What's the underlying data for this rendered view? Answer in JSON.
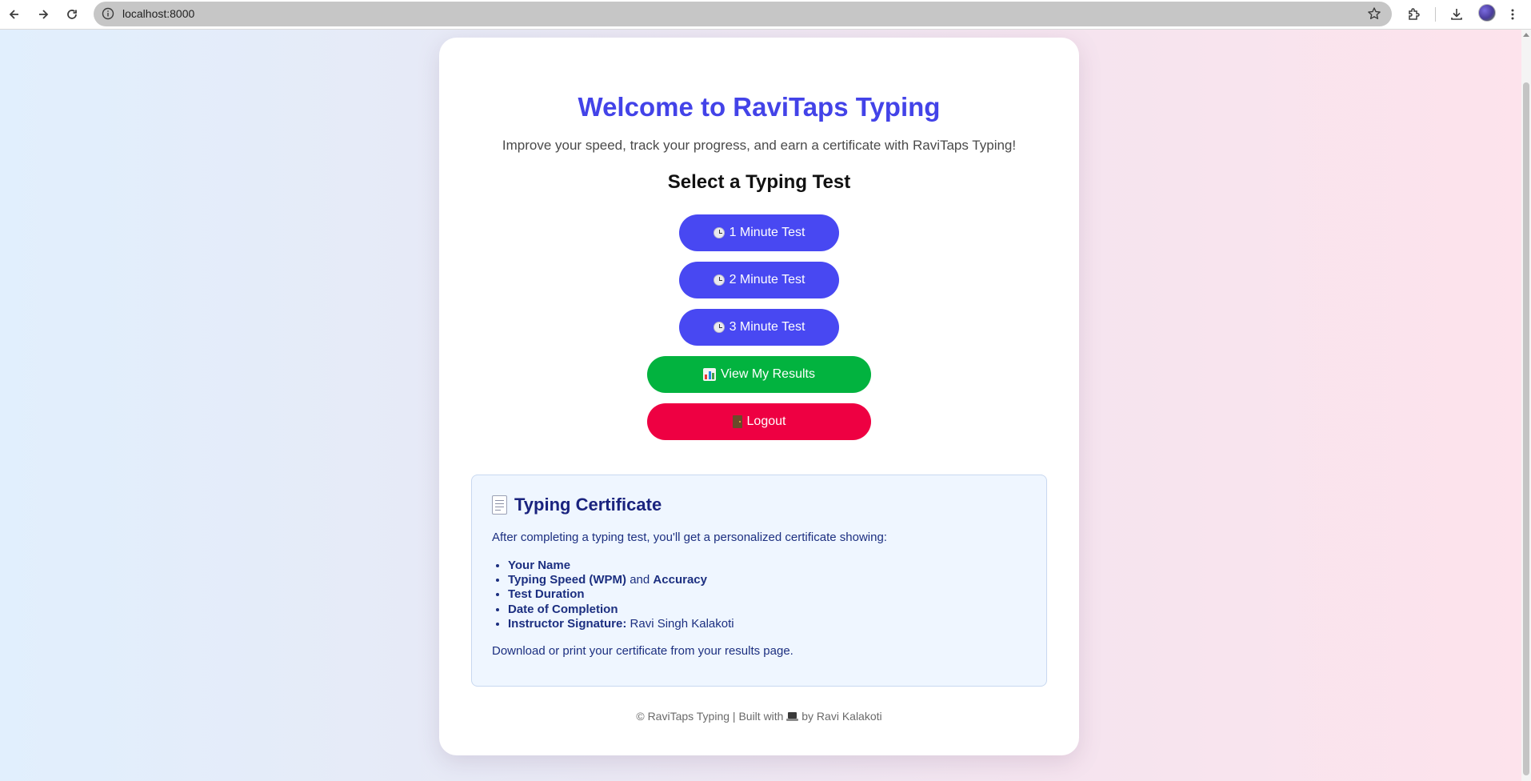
{
  "browser": {
    "url": "localhost:8000"
  },
  "page": {
    "title": "Welcome to RaviTaps Typing",
    "subtitle": "Improve your speed, track your progress, and earn a certificate with RaviTaps Typing!",
    "select_heading": "Select a Typing Test",
    "buttons": {
      "test_1": "1 Minute Test",
      "test_2": "2 Minute Test",
      "test_3": "3 Minute Test",
      "results": "View My Results",
      "logout": "Logout"
    },
    "certificate": {
      "title": "Typing Certificate",
      "intro": "After completing a typing test, you'll get a personalized certificate showing:",
      "items": {
        "name": "Your Name",
        "speed": "Typing Speed (WPM)",
        "and": "and",
        "accuracy": "Accuracy",
        "duration": "Test Duration",
        "date": "Date of Completion",
        "signature_label": "Instructor Signature:",
        "signature_value": "Ravi Singh Kalakoti"
      },
      "outro": "Download or print your certificate from your results page."
    },
    "footer": {
      "left": "© RaviTaps Typing | Built with",
      "right": "by Ravi Kalakoti"
    },
    "colors": {
      "title": "#4343e8",
      "test_button": "#4848f2",
      "results_button": "#02b33f",
      "logout_button": "#ee0042"
    }
  }
}
